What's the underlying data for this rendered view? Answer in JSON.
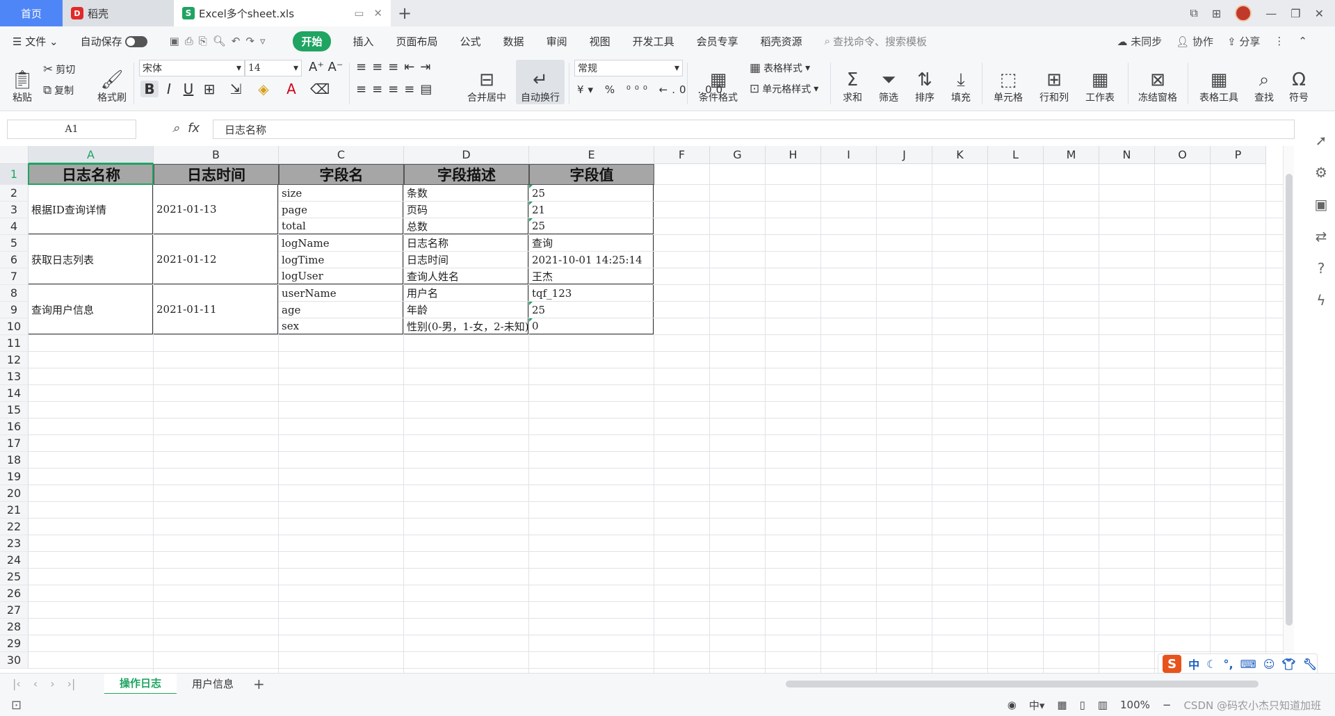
{
  "tabs": {
    "home": "首页",
    "docer": "稻壳",
    "excel": "Excel多个sheet.xls"
  },
  "menubar": {
    "file": "文件",
    "autosave": "自动保存",
    "items": [
      "开始",
      "插入",
      "页面布局",
      "公式",
      "数据",
      "审阅",
      "视图",
      "开发工具",
      "会员专享",
      "稻壳资源"
    ],
    "search_placeholder": "查找命令、搜索模板",
    "unsynced": "未同步",
    "collab": "协作",
    "share": "分享"
  },
  "ribbon": {
    "paste": "粘贴",
    "cut": "剪切",
    "copy": "复制",
    "format_painter": "格式刷",
    "font_name": "宋体",
    "font_size": "14",
    "merge_center": "合并居中",
    "wrap_text": "自动换行",
    "number_format": "常规",
    "table_style": "表格样式",
    "cond_format": "条件格式",
    "cell_style": "单元格样式",
    "sum": "求和",
    "filter": "筛选",
    "sort": "排序",
    "fill": "填充",
    "cell": "单元格",
    "row_col": "行和列",
    "worksheet": "工作表",
    "freeze": "冻结窗格",
    "table_tools": "表格工具",
    "find": "查找",
    "symbol": "符号"
  },
  "formula_bar": {
    "cell_ref": "A1",
    "content": "日志名称"
  },
  "grid": {
    "columns": [
      "A",
      "B",
      "C",
      "D",
      "E",
      "F",
      "G",
      "H",
      "I",
      "J",
      "K",
      "L",
      "M",
      "N",
      "O",
      "P"
    ],
    "rows": [
      "1",
      "2",
      "3",
      "4",
      "5",
      "6",
      "7",
      "8",
      "9",
      "10",
      "11",
      "12",
      "13",
      "14",
      "15",
      "16",
      "17",
      "18",
      "19",
      "20",
      "21",
      "22",
      "23",
      "24",
      "25",
      "26",
      "27",
      "28",
      "29",
      "30"
    ],
    "headers": [
      "日志名称",
      "日志时间",
      "字段名",
      "字段描述",
      "字段值"
    ],
    "groups": [
      {
        "name": "根据ID查询详情",
        "time": "2021-01-13"
      },
      {
        "name": "获取日志列表",
        "time": "2021-01-12"
      },
      {
        "name": "查询用户信息",
        "time": "2021-01-11"
      }
    ],
    "fields": [
      {
        "field": "size",
        "desc": "条数",
        "value": "25"
      },
      {
        "field": "page",
        "desc": "页码",
        "value": "21"
      },
      {
        "field": "total",
        "desc": "总数",
        "value": "25"
      },
      {
        "field": "logName",
        "desc": "日志名称",
        "value": "查询"
      },
      {
        "field": "logTime",
        "desc": "日志时间",
        "value": "2021-10-01 14:25:14"
      },
      {
        "field": "logUser",
        "desc": "查询人姓名",
        "value": "王杰"
      },
      {
        "field": "userName",
        "desc": "用户名",
        "value": "tqf_123"
      },
      {
        "field": "age",
        "desc": "年龄",
        "value": "25"
      },
      {
        "field": "sex",
        "desc": "性别(0-男，1-女，2-未知)",
        "value": "0"
      }
    ]
  },
  "sheets": [
    "操作日志",
    "用户信息"
  ],
  "status": {
    "zoom": "100%",
    "ime_lang": "中",
    "watermark": "CSDN @码农小杰只知道加班"
  }
}
